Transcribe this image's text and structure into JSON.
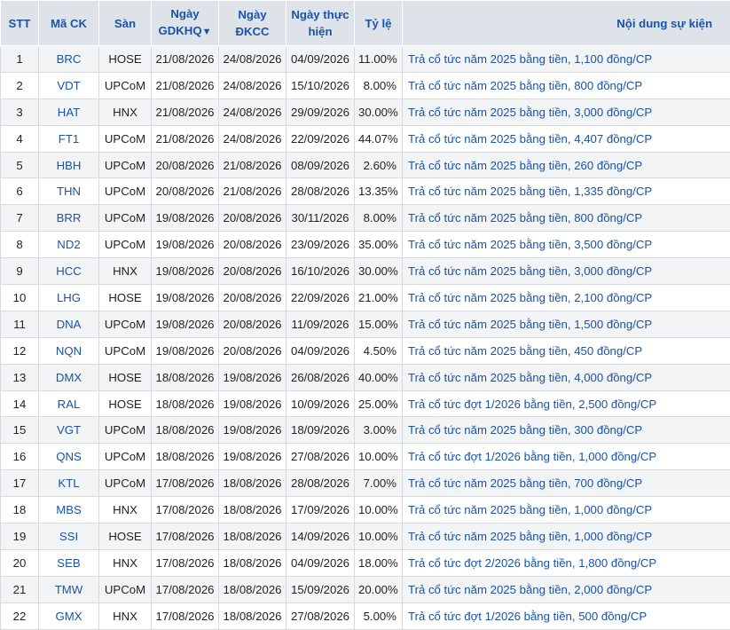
{
  "headers": {
    "stt": "STT",
    "ma_ck": "Mã CK",
    "san": "Sàn",
    "gdkhq_l1": "Ngày",
    "gdkhq_l2": "GDKHQ",
    "gdkhq_sort": "▼",
    "dkcc_l1": "Ngày",
    "dkcc_l2": "ĐKCC",
    "th_l1": "Ngày thực",
    "th_l2": "hiện",
    "ty_le": "Tỷ lệ",
    "noi_dung": "Nội dung sự kiện"
  },
  "rows": [
    {
      "stt": "1",
      "ma": "BRC",
      "san": "HOSE",
      "gdkhq": "21/08/2026",
      "dkcc": "24/08/2026",
      "th": "04/09/2026",
      "ty_le": "11.00%",
      "noi_dung": "Trả cổ tức năm 2025 bằng tiền, 1,100 đồng/CP"
    },
    {
      "stt": "2",
      "ma": "VDT",
      "san": "UPCoM",
      "gdkhq": "21/08/2026",
      "dkcc": "24/08/2026",
      "th": "15/10/2026",
      "ty_le": "8.00%",
      "noi_dung": "Trả cổ tức năm 2025 bằng tiền, 800 đồng/CP"
    },
    {
      "stt": "3",
      "ma": "HAT",
      "san": "HNX",
      "gdkhq": "21/08/2026",
      "dkcc": "24/08/2026",
      "th": "29/09/2026",
      "ty_le": "30.00%",
      "noi_dung": "Trả cổ tức năm 2025 bằng tiền, 3,000 đồng/CP"
    },
    {
      "stt": "4",
      "ma": "FT1",
      "san": "UPCoM",
      "gdkhq": "21/08/2026",
      "dkcc": "24/08/2026",
      "th": "22/09/2026",
      "ty_le": "44.07%",
      "noi_dung": "Trả cổ tức năm 2025 bằng tiền, 4,407 đồng/CP"
    },
    {
      "stt": "5",
      "ma": "HBH",
      "san": "UPCoM",
      "gdkhq": "20/08/2026",
      "dkcc": "21/08/2026",
      "th": "08/09/2026",
      "ty_le": "2.60%",
      "noi_dung": "Trả cổ tức năm 2025 bằng tiền, 260 đồng/CP"
    },
    {
      "stt": "6",
      "ma": "THN",
      "san": "UPCoM",
      "gdkhq": "20/08/2026",
      "dkcc": "21/08/2026",
      "th": "28/08/2026",
      "ty_le": "13.35%",
      "noi_dung": "Trả cổ tức năm 2025 bằng tiền, 1,335 đồng/CP"
    },
    {
      "stt": "7",
      "ma": "BRR",
      "san": "UPCoM",
      "gdkhq": "19/08/2026",
      "dkcc": "20/08/2026",
      "th": "30/11/2026",
      "ty_le": "8.00%",
      "noi_dung": "Trả cổ tức năm 2025 bằng tiền, 800 đồng/CP"
    },
    {
      "stt": "8",
      "ma": "ND2",
      "san": "UPCoM",
      "gdkhq": "19/08/2026",
      "dkcc": "20/08/2026",
      "th": "23/09/2026",
      "ty_le": "35.00%",
      "noi_dung": "Trả cổ tức năm 2025 bằng tiền, 3,500 đồng/CP"
    },
    {
      "stt": "9",
      "ma": "HCC",
      "san": "HNX",
      "gdkhq": "19/08/2026",
      "dkcc": "20/08/2026",
      "th": "16/10/2026",
      "ty_le": "30.00%",
      "noi_dung": "Trả cổ tức năm 2025 bằng tiền, 3,000 đồng/CP"
    },
    {
      "stt": "10",
      "ma": "LHG",
      "san": "HOSE",
      "gdkhq": "19/08/2026",
      "dkcc": "20/08/2026",
      "th": "22/09/2026",
      "ty_le": "21.00%",
      "noi_dung": "Trả cổ tức năm 2025 bằng tiền, 2,100 đồng/CP"
    },
    {
      "stt": "11",
      "ma": "DNA",
      "san": "UPCoM",
      "gdkhq": "19/08/2026",
      "dkcc": "20/08/2026",
      "th": "11/09/2026",
      "ty_le": "15.00%",
      "noi_dung": "Trả cổ tức năm 2025 bằng tiền, 1,500 đồng/CP"
    },
    {
      "stt": "12",
      "ma": "NQN",
      "san": "UPCoM",
      "gdkhq": "19/08/2026",
      "dkcc": "20/08/2026",
      "th": "04/09/2026",
      "ty_le": "4.50%",
      "noi_dung": "Trả cổ tức năm 2025 bằng tiền, 450 đồng/CP"
    },
    {
      "stt": "13",
      "ma": "DMX",
      "san": "HOSE",
      "gdkhq": "18/08/2026",
      "dkcc": "19/08/2026",
      "th": "26/08/2026",
      "ty_le": "40.00%",
      "noi_dung": "Trả cổ tức năm 2025 bằng tiền, 4,000 đồng/CP"
    },
    {
      "stt": "14",
      "ma": "RAL",
      "san": "HOSE",
      "gdkhq": "18/08/2026",
      "dkcc": "19/08/2026",
      "th": "10/09/2026",
      "ty_le": "25.00%",
      "noi_dung": "Trả cổ tức đợt 1/2026 bằng tiền, 2,500 đồng/CP"
    },
    {
      "stt": "15",
      "ma": "VGT",
      "san": "UPCoM",
      "gdkhq": "18/08/2026",
      "dkcc": "19/08/2026",
      "th": "18/09/2026",
      "ty_le": "3.00%",
      "noi_dung": "Trả cổ tức năm 2025 bằng tiền, 300 đồng/CP"
    },
    {
      "stt": "16",
      "ma": "QNS",
      "san": "UPCoM",
      "gdkhq": "18/08/2026",
      "dkcc": "19/08/2026",
      "th": "27/08/2026",
      "ty_le": "10.00%",
      "noi_dung": "Trả cổ tức đợt 1/2026 bằng tiền, 1,000 đồng/CP"
    },
    {
      "stt": "17",
      "ma": "KTL",
      "san": "UPCoM",
      "gdkhq": "17/08/2026",
      "dkcc": "18/08/2026",
      "th": "28/08/2026",
      "ty_le": "7.00%",
      "noi_dung": "Trả cổ tức năm 2025 bằng tiền, 700 đồng/CP"
    },
    {
      "stt": "18",
      "ma": "MBS",
      "san": "HNX",
      "gdkhq": "17/08/2026",
      "dkcc": "18/08/2026",
      "th": "17/09/2026",
      "ty_le": "10.00%",
      "noi_dung": "Trả cổ tức năm 2025 bằng tiền, 1,000 đồng/CP"
    },
    {
      "stt": "19",
      "ma": "SSI",
      "san": "HOSE",
      "gdkhq": "17/08/2026",
      "dkcc": "18/08/2026",
      "th": "14/09/2026",
      "ty_le": "10.00%",
      "noi_dung": "Trả cổ tức năm 2025 bằng tiền, 1,000 đồng/CP"
    },
    {
      "stt": "20",
      "ma": "SEB",
      "san": "HNX",
      "gdkhq": "17/08/2026",
      "dkcc": "18/08/2026",
      "th": "04/09/2026",
      "ty_le": "18.00%",
      "noi_dung": "Trả cổ tức đợt 2/2026 bằng tiền, 1,800 đồng/CP"
    },
    {
      "stt": "21",
      "ma": "TMW",
      "san": "UPCoM",
      "gdkhq": "17/08/2026",
      "dkcc": "18/08/2026",
      "th": "15/09/2026",
      "ty_le": "20.00%",
      "noi_dung": "Trả cổ tức năm 2025 bằng tiền, 2,000 đồng/CP"
    },
    {
      "stt": "22",
      "ma": "GMX",
      "san": "HNX",
      "gdkhq": "17/08/2026",
      "dkcc": "18/08/2026",
      "th": "27/08/2026",
      "ty_le": "5.00%",
      "noi_dung": "Trả cổ tức đợt 1/2026 bằng tiền, 500 đồng/CP"
    }
  ]
}
